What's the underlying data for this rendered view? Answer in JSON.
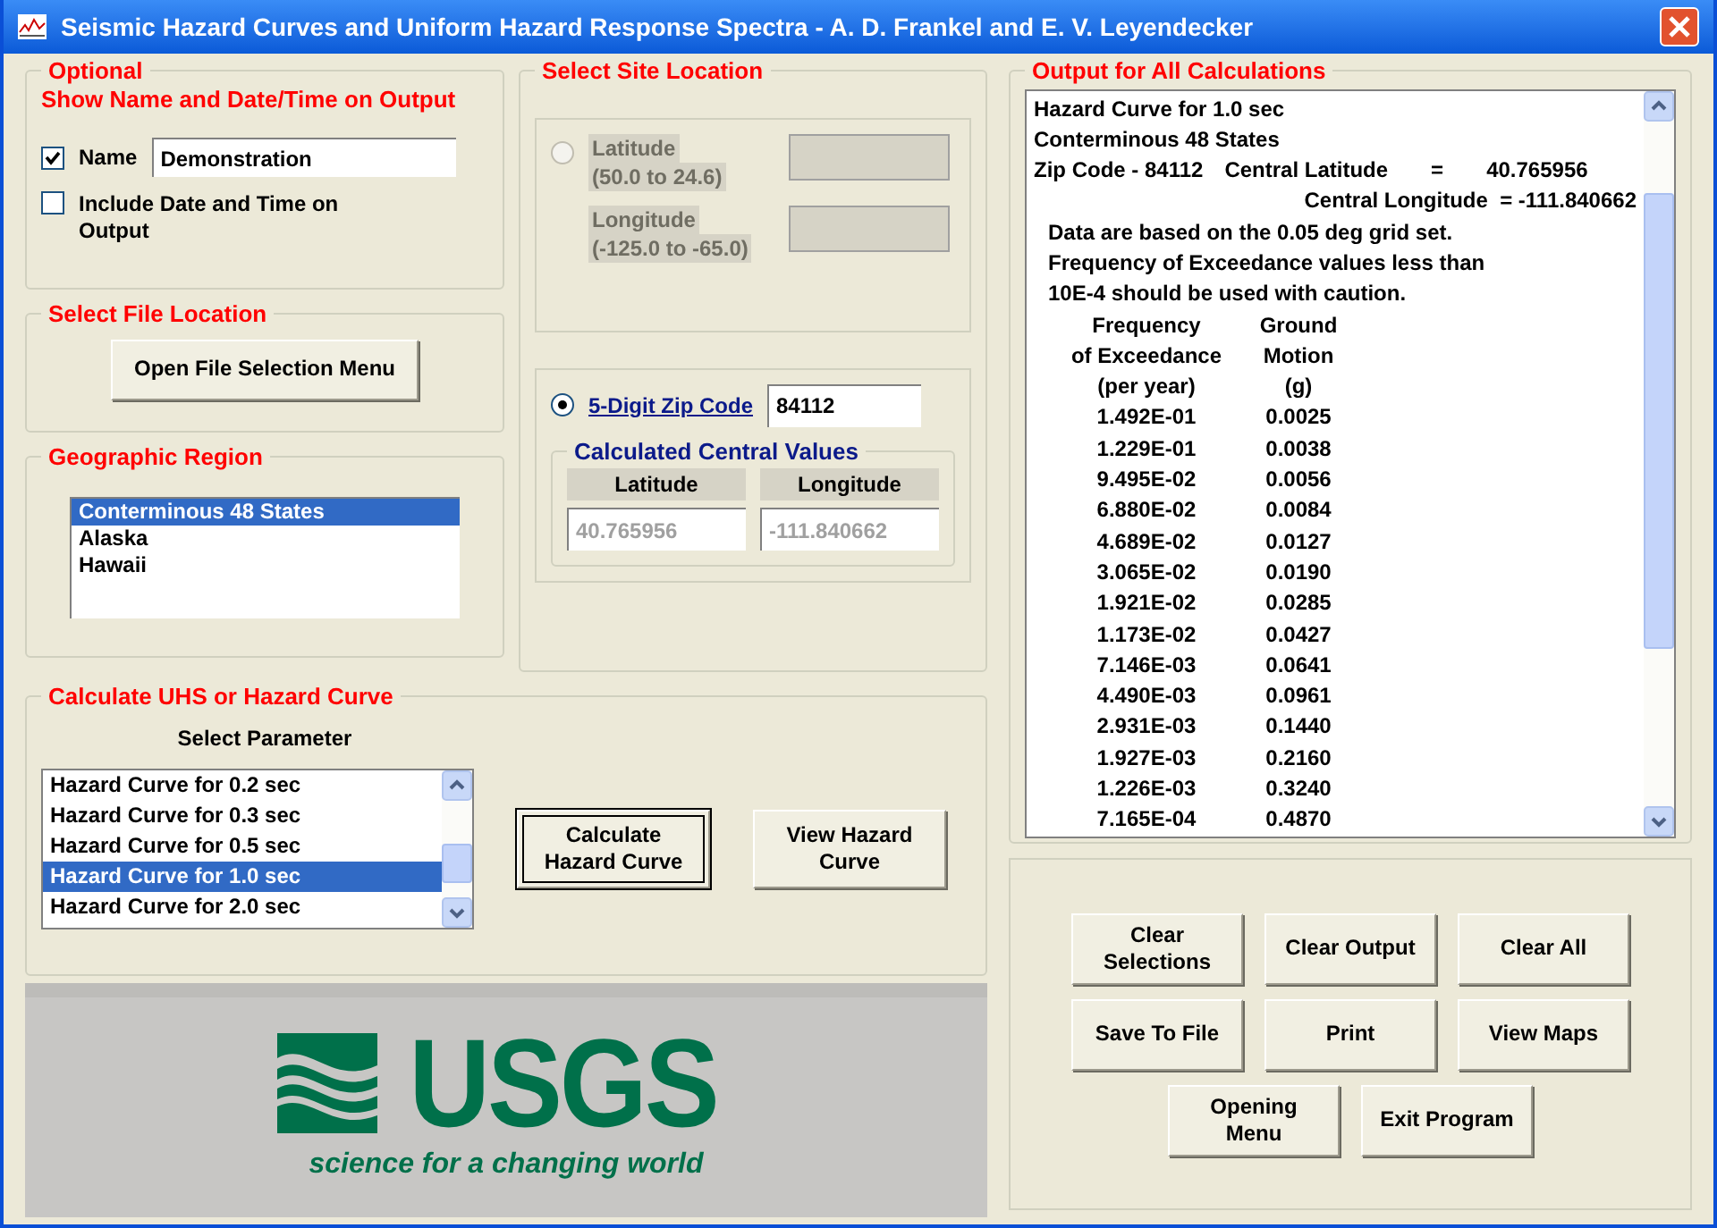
{
  "window": {
    "title": "Seismic Hazard Curves and Uniform Hazard Response Spectra - A. D. Frankel and E. V. Leyendecker"
  },
  "optional": {
    "title": "Optional",
    "subtitle": "Show Name and Date/Time on Output",
    "name_checkbox": {
      "label": "Name",
      "checked": true
    },
    "name_value": "Demonstration",
    "date_checkbox": {
      "label": "Include Date and Time on Output",
      "checked": false
    }
  },
  "file_location": {
    "title": "Select File Location",
    "button": "Open File Selection Menu"
  },
  "region": {
    "title": "Geographic Region",
    "items": [
      {
        "label": "Conterminous 48 States",
        "selected": true
      },
      {
        "label": "Alaska",
        "selected": false
      },
      {
        "label": "Hawaii",
        "selected": false
      }
    ]
  },
  "site": {
    "title": "Select Site Location",
    "latlon": {
      "selected": false,
      "lat_label": "Latitude",
      "lat_range": "(50.0 to 24.6)",
      "lon_label": "Longitude",
      "lon_range": "(-125.0 to -65.0)"
    },
    "zip": {
      "selected": true,
      "label": "5-Digit Zip Code",
      "value": "84112"
    },
    "central": {
      "title": "Calculated Central Values",
      "lat_label": "Latitude",
      "lon_label": "Longitude",
      "lat_value": "40.765956",
      "lon_value": "-111.840662"
    }
  },
  "calculate": {
    "title": "Calculate UHS or Hazard Curve",
    "param_label": "Select Parameter",
    "items": [
      {
        "label": "Hazard Curve for 0.2 sec",
        "selected": false
      },
      {
        "label": "Hazard Curve for 0.3 sec",
        "selected": false
      },
      {
        "label": "Hazard Curve for 0.5 sec",
        "selected": false
      },
      {
        "label": "Hazard Curve for 1.0 sec",
        "selected": true
      },
      {
        "label": "Hazard Curve for 2.0 sec",
        "selected": false
      }
    ],
    "buttons": [
      {
        "label": "Calculate Hazard Curve",
        "focused": true
      },
      {
        "label": "View Hazard Curve",
        "focused": false
      }
    ]
  },
  "logo": {
    "wordmark": "USGS",
    "tagline": "science for a changing world"
  },
  "output": {
    "title": "Output for All Calculations",
    "heading_lines": [
      "Hazard Curve for 1.0 sec",
      "Conterminous 48 States"
    ],
    "zip_line": {
      "zip": "Zip Code - 84112",
      "lat_label": "Central Latitude",
      "equals": "=",
      "lat_value": "40.765956"
    },
    "lon_line": "Central Longitude  = -111.840662",
    "notes": [
      "Data are based on the 0.05 deg grid set.",
      "Frequency of Exceedance values less than",
      "10E-4 should be used with caution."
    ],
    "header_rows": [
      [
        "Frequency",
        "Ground"
      ],
      [
        "of Exceedance",
        "Motion"
      ],
      [
        "(per year)",
        "(g)"
      ]
    ],
    "rows": [
      [
        "1.492E-01",
        "0.0025"
      ],
      [
        "1.229E-01",
        "0.0038"
      ],
      [
        "9.495E-02",
        "0.0056"
      ],
      [
        "6.880E-02",
        "0.0084"
      ],
      [
        "4.689E-02",
        "0.0127"
      ],
      [
        "3.065E-02",
        "0.0190"
      ],
      [
        "1.921E-02",
        "0.0285"
      ],
      [
        "1.173E-02",
        "0.0427"
      ],
      [
        "7.146E-03",
        "0.0641"
      ],
      [
        "4.490E-03",
        "0.0961"
      ],
      [
        "2.931E-03",
        "0.1440"
      ],
      [
        "1.927E-03",
        "0.2160"
      ],
      [
        "1.226E-03",
        "0.3240"
      ],
      [
        "7.165E-04",
        "0.4870"
      ]
    ]
  },
  "actions": [
    [
      "Clear Selections",
      "Clear Output",
      "Clear All"
    ],
    [
      "Save To File",
      "Print",
      "View Maps"
    ],
    [
      "Opening Menu",
      "Exit Program"
    ]
  ]
}
